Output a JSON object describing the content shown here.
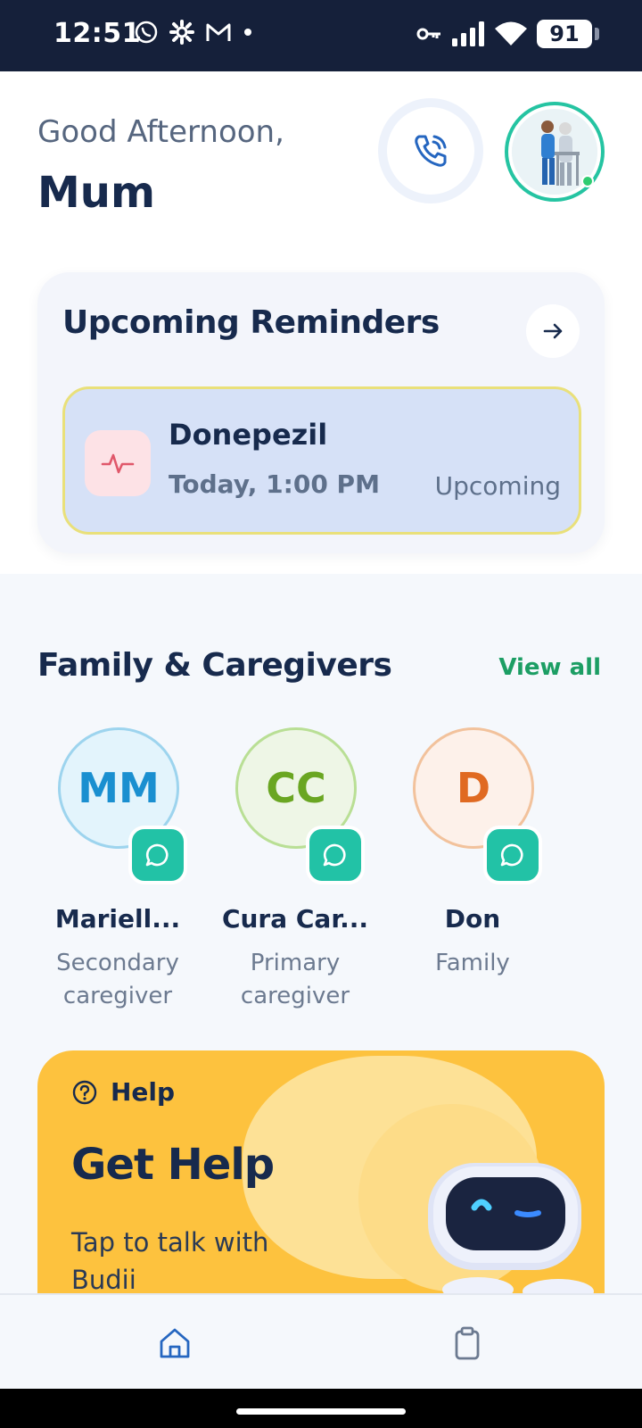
{
  "status_bar": {
    "time": "12:51",
    "battery": "91",
    "left_icons": [
      "whatsapp-icon",
      "settings-icon",
      "gmail-icon",
      "dot-icon"
    ],
    "right_icons": [
      "vpn-key-icon",
      "signal-icon",
      "wifi-icon",
      "battery-icon"
    ]
  },
  "header": {
    "greeting": "Good Afternoon,",
    "user_name": "Mum"
  },
  "reminders": {
    "title": "Upcoming Reminders",
    "items": [
      {
        "name": "Donepezil",
        "time": "Today, 1:00 PM",
        "status": "Upcoming",
        "icon": "heart-pulse-icon"
      }
    ]
  },
  "family": {
    "title": "Family & Caregivers",
    "view_all": "View all",
    "members": [
      {
        "initials": "MM",
        "name": "Mariell...",
        "role": "Secondary caregiver",
        "color": "#1a8fd0",
        "bg": "#e3f4fc",
        "border": "#9dd4ee"
      },
      {
        "initials": "CC",
        "name": "Cura Car...",
        "role": "Primary caregiver",
        "color": "#6aa622",
        "bg": "#eef6e6",
        "border": "#b9df95"
      },
      {
        "initials": "D",
        "name": "Don",
        "role": "Family",
        "color": "#e06a22",
        "bg": "#fdf1ea",
        "border": "#f2c29c"
      }
    ]
  },
  "help": {
    "tag": "Help",
    "title": "Get Help",
    "subtitle": "Tap to talk with Budii"
  },
  "colors": {
    "accent_teal": "#22c2a6",
    "accent_green": "#1c9e64",
    "navy": "#172a4d",
    "help_yellow": "#fdc23e"
  }
}
